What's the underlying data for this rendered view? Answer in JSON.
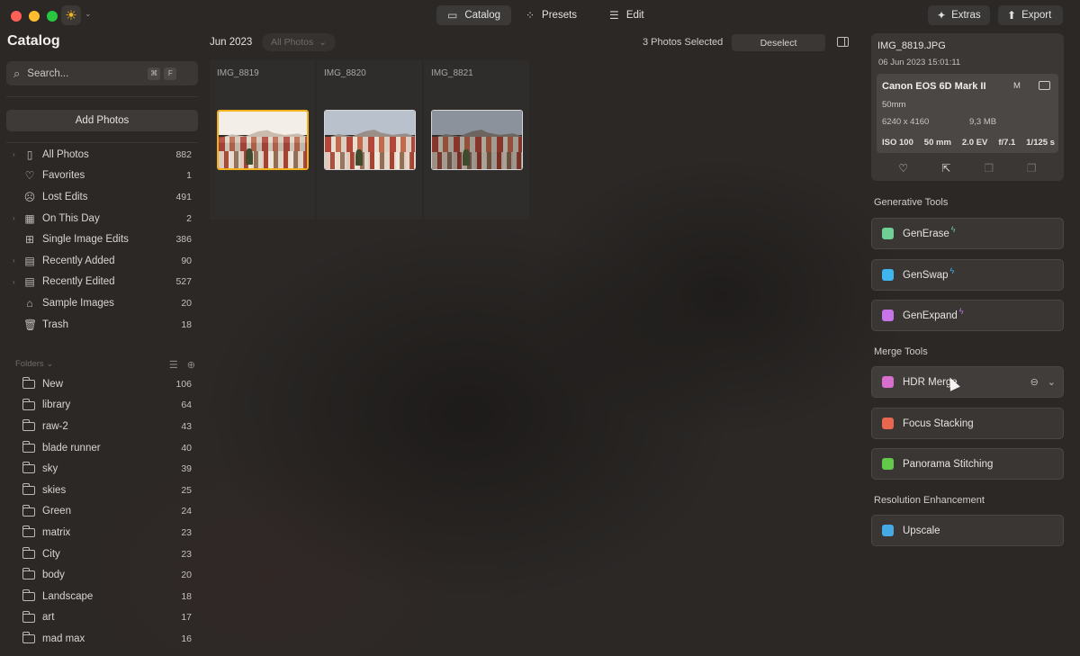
{
  "topbar": {
    "tabs": [
      {
        "label": "Catalog",
        "icon": "folder-icon",
        "active": true
      },
      {
        "label": "Presets",
        "icon": "magic-wand-icon",
        "active": false
      },
      {
        "label": "Edit",
        "icon": "sliders-icon",
        "active": false
      }
    ],
    "extras_label": "Extras",
    "export_label": "Export"
  },
  "sidebar": {
    "title": "Catalog",
    "search_placeholder": "Search...",
    "search_kbd1": "⌘",
    "search_kbd2": "F",
    "add_photos_label": "Add Photos",
    "items": [
      {
        "label": "All Photos",
        "count": "882",
        "icon": "phone-stack-icon",
        "chevron": true
      },
      {
        "label": "Favorites",
        "count": "1",
        "icon": "heart-icon",
        "chevron": false
      },
      {
        "label": "Lost Edits",
        "count": "491",
        "icon": "sad-face-icon",
        "chevron": false
      },
      {
        "label": "On This Day",
        "count": "2",
        "icon": "calendar-icon",
        "chevron": true
      },
      {
        "label": "Single Image Edits",
        "count": "386",
        "icon": "grid-icon",
        "chevron": false
      },
      {
        "label": "Recently Added",
        "count": "90",
        "icon": "calendar-plus-icon",
        "chevron": true
      },
      {
        "label": "Recently Edited",
        "count": "527",
        "icon": "calendar-edit-icon",
        "chevron": true
      },
      {
        "label": "Sample Images",
        "count": "20",
        "icon": "graduation-cap-icon",
        "chevron": false
      },
      {
        "label": "Trash",
        "count": "18",
        "icon": "trash-icon",
        "chevron": false
      }
    ],
    "folders_label": "Folders",
    "folders": [
      {
        "label": "New",
        "count": "106"
      },
      {
        "label": "library",
        "count": "64"
      },
      {
        "label": "raw-2",
        "count": "43"
      },
      {
        "label": "blade runner",
        "count": "40"
      },
      {
        "label": "sky",
        "count": "39"
      },
      {
        "label": "skies",
        "count": "25"
      },
      {
        "label": "Green",
        "count": "24"
      },
      {
        "label": "matrix",
        "count": "23"
      },
      {
        "label": "City",
        "count": "23"
      },
      {
        "label": "body",
        "count": "20"
      },
      {
        "label": "Landscape",
        "count": "18"
      },
      {
        "label": "art",
        "count": "17"
      },
      {
        "label": "mad max",
        "count": "16"
      }
    ]
  },
  "center": {
    "month": "Jun 2023",
    "filter_label": "All Photos",
    "selected_text": "3 Photos Selected",
    "deselect_label": "Deselect",
    "photos": [
      {
        "name": "IMG_8819",
        "selected": true
      },
      {
        "name": "IMG_8820",
        "selected": false
      },
      {
        "name": "IMG_8821",
        "selected": false
      }
    ]
  },
  "info": {
    "filename": "IMG_8819.JPG",
    "datetime": "06 Jun 2023 15:01:11",
    "camera": "Canon EOS 6D Mark II",
    "mode": "M",
    "lens": "50mm",
    "dimensions": "6240 x 4160",
    "filesize": "9,3 MB",
    "iso": "ISO 100",
    "focal": "50 mm",
    "ev": "2.0 EV",
    "aperture": "f/7.1",
    "shutter": "1/125 s"
  },
  "tools": {
    "generative_title": "Generative Tools",
    "generative": [
      {
        "label": "GenErase",
        "icon": "eraser-icon",
        "color": "#6fcf97"
      },
      {
        "label": "GenSwap",
        "icon": "swap-icon",
        "color": "#3fb6f0"
      },
      {
        "label": "GenExpand",
        "icon": "expand-icon",
        "color": "#c774e8"
      }
    ],
    "merge_title": "Merge Tools",
    "merge": [
      {
        "label": "HDR Merge",
        "icon": "hdr-icon",
        "color": "#d86fd0"
      },
      {
        "label": "Focus Stacking",
        "icon": "focus-icon",
        "color": "#e9664f"
      },
      {
        "label": "Panorama Stitching",
        "icon": "panorama-icon",
        "color": "#63c94a"
      }
    ],
    "resolution_title": "Resolution Enhancement",
    "resolution": [
      {
        "label": "Upscale",
        "icon": "upscale-icon",
        "color": "#45a9e6"
      }
    ]
  }
}
